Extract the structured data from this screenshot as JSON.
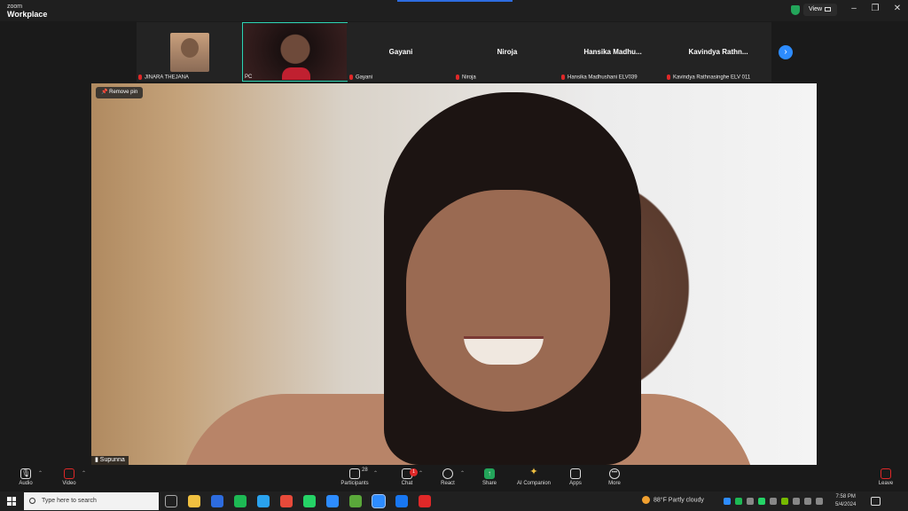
{
  "app": {
    "logo_top": "zoom",
    "logo_bottom": "Workplace",
    "view_label": "View"
  },
  "window_controls": [
    "–",
    "❐",
    "✕"
  ],
  "strip": {
    "tiles": [
      {
        "label": "JINARA THEJANA",
        "name": "",
        "active": false,
        "has_video": true
      },
      {
        "label": "PC",
        "name": "",
        "active": true,
        "has_video": true
      },
      {
        "label": "Gayani",
        "name": "Gayani",
        "active": false,
        "has_video": false
      },
      {
        "label": "Niroja",
        "name": "Niroja",
        "active": false,
        "has_video": false
      },
      {
        "label": "Hansika Madhushani ELV039",
        "name": "Hansika  Madhu...",
        "active": false,
        "has_video": false
      },
      {
        "label": "Kavindya Rathnasinghe ELV 011",
        "name": "Kavindya  Rathn...",
        "active": false,
        "has_video": false
      }
    ],
    "next_icon": "chevron-right-icon"
  },
  "stage": {
    "remove_pin": "Remove pin",
    "speaker_name": "Supunna"
  },
  "toolbar": {
    "audio": "Audio",
    "video": "Video",
    "participants": "Participants",
    "participants_count": "28",
    "chat": "Chat",
    "chat_badge": "1",
    "react": "React",
    "share": "Share",
    "ai_companion": "AI Companion",
    "apps": "Apps",
    "more": "More",
    "leave": "Leave"
  },
  "taskbar": {
    "search_placeholder": "Type here to search",
    "weather": "88°F  Partly cloudy",
    "time": "7:58 PM",
    "date": "5/4/2024",
    "app_colors": [
      "#f0c040",
      "#2d6cdf",
      "#1db954",
      "#2aa3ef",
      "#e84a3a",
      "#25d366",
      "#2d8cff",
      "#5aa83a",
      "#2d8cff",
      "#1877f2",
      "#e02828"
    ]
  }
}
